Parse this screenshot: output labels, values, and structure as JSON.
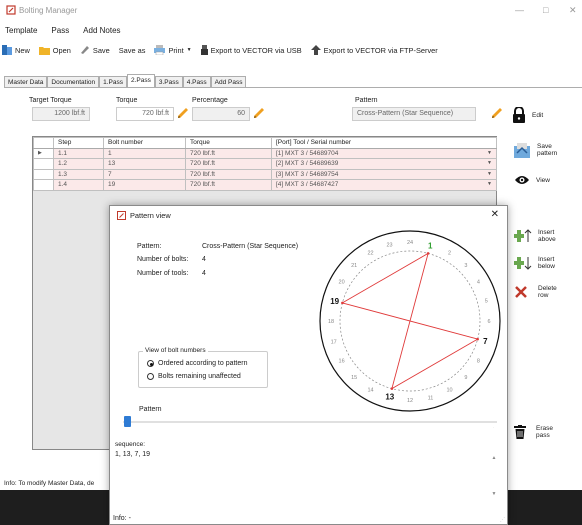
{
  "window": {
    "title": "Bolting Manager",
    "min": "—",
    "max": "□",
    "close": "✕"
  },
  "menu": [
    "Template",
    "Pass",
    "Add Notes"
  ],
  "toolbar": {
    "new": "New",
    "open": "Open",
    "save": "Save",
    "save_as": "Save as",
    "print": "Print",
    "export_usb": "Export to VECTOR via USB",
    "export_ftp": "Export to VECTOR via FTP-Server"
  },
  "tabs": [
    "Master Data",
    "Documentation",
    "1.Pass",
    "2.Pass",
    "3.Pass",
    "4.Pass",
    "Add Pass"
  ],
  "active_tab": "2.Pass",
  "fields": {
    "target_torque_label": "Target Torque",
    "target_torque_value": "1200 lbf.ft",
    "torque_label": "Torque",
    "torque_value": "720 lbf.ft",
    "percentage_label": "Percentage",
    "percentage_value": "60",
    "pattern_label": "Pattern",
    "pattern_value": "Cross-Pattern (Star Sequence)"
  },
  "grid": {
    "headers": [
      "Step",
      "Bolt number",
      "Torque",
      "[Port] Tool / Serial number"
    ],
    "rows": [
      {
        "step": "1.1",
        "bolt": "1",
        "torque": "720 lbf.ft",
        "tool": "[1] MXT 3 / 54689704"
      },
      {
        "step": "1.2",
        "bolt": "13",
        "torque": "720 lbf.ft",
        "tool": "[2] MXT 3 / 54689639"
      },
      {
        "step": "1.3",
        "bolt": "7",
        "torque": "720 lbf.ft",
        "tool": "[3] MXT 3 / 54689754"
      },
      {
        "step": "1.4",
        "bolt": "19",
        "torque": "720 lbf.ft",
        "tool": "[4] MXT 3 / 54687427"
      }
    ]
  },
  "side_buttons": {
    "edit": "Edit",
    "save_pattern": "Save pattern",
    "view": "View",
    "insert_above": "Insert above",
    "insert_below": "Insert below",
    "delete_row": "Delete row",
    "erase_pass": "Erase pass"
  },
  "status": "Info:  To modify Master Data, de",
  "dialog": {
    "title": "Pattern view",
    "pattern_label": "Pattern:",
    "pattern_value": "Cross-Pattern (Star Sequence)",
    "bolts_label": "Number of bolts:",
    "bolts_value": "4",
    "tools_label": "Number of tools:",
    "tools_value": "4",
    "view_group": "View of bolt numbers",
    "opt1": "Ordered according to pattern",
    "opt2": "Bolts remaining unaffected",
    "slider_label": "Pattern",
    "sequence_label": "sequence:",
    "sequence_value": "1, 13, 7, 19",
    "info": "Info:  -",
    "dial_numbers": [
      "1",
      "2",
      "3",
      "4",
      "5",
      "6",
      "7",
      "8",
      "9",
      "10",
      "11",
      "12",
      "13",
      "14",
      "15",
      "16",
      "17",
      "18",
      "19",
      "20",
      "21",
      "22",
      "23",
      "24"
    ],
    "highlight_bolts": [
      "1",
      "7",
      "13",
      "19"
    ]
  }
}
